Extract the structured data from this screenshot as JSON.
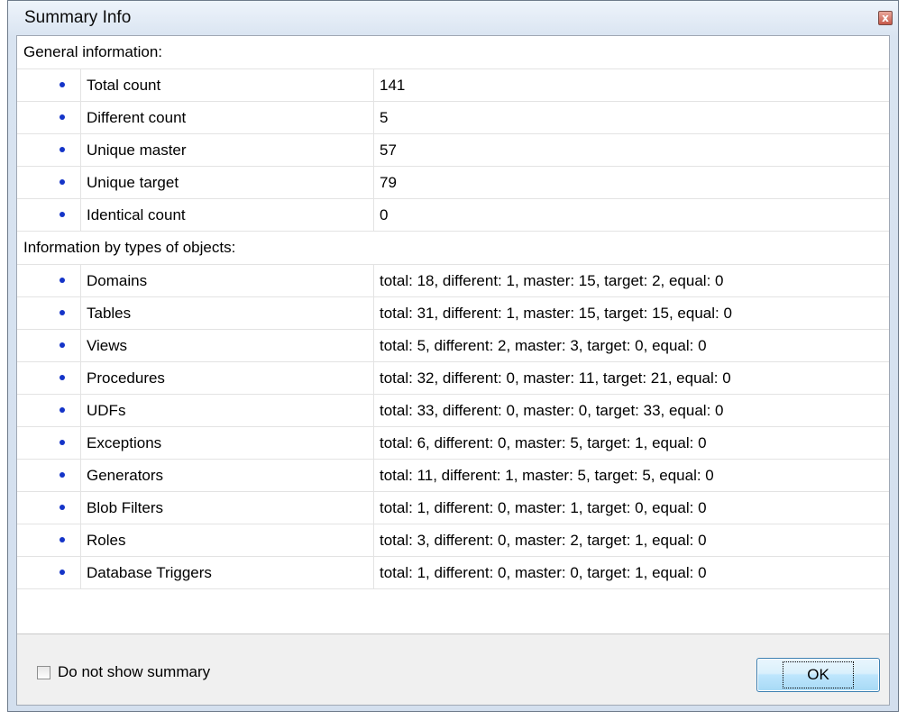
{
  "window": {
    "title": "Summary Info",
    "close_label": "x"
  },
  "general": {
    "header": "General information:",
    "rows": [
      {
        "name": "Total count",
        "value": "141"
      },
      {
        "name": "Different count",
        "value": "5"
      },
      {
        "name": "Unique master",
        "value": "57"
      },
      {
        "name": "Unique target",
        "value": "79"
      },
      {
        "name": "Identical count",
        "value": "0"
      }
    ]
  },
  "by_types": {
    "header": "Information by types of objects:",
    "rows": [
      {
        "name": "Domains",
        "value": "total: 18, different: 1, master: 15, target: 2, equal: 0"
      },
      {
        "name": "Tables",
        "value": "total: 31, different: 1, master: 15, target: 15, equal: 0"
      },
      {
        "name": "Views",
        "value": "total: 5, different: 2, master: 3, target: 0, equal: 0"
      },
      {
        "name": "Procedures",
        "value": "total: 32, different: 0, master: 11, target: 21, equal: 0"
      },
      {
        "name": "UDFs",
        "value": "total: 33, different: 0, master: 0, target: 33, equal: 0"
      },
      {
        "name": "Exceptions",
        "value": "total: 6, different: 0, master: 5, target: 1, equal: 0"
      },
      {
        "name": "Generators",
        "value": "total: 11, different: 1, master: 5, target: 5, equal: 0"
      },
      {
        "name": "Blob Filters",
        "value": "total: 1, different: 0, master: 1, target: 0, equal: 0"
      },
      {
        "name": "Roles",
        "value": "total: 3, different: 0, master: 2, target: 1, equal: 0"
      },
      {
        "name": "Database Triggers",
        "value": "total: 1, different: 0, master: 0, target: 1, equal: 0"
      }
    ]
  },
  "footer": {
    "checkbox_label": "Do not show summary",
    "checkbox_checked": false,
    "ok_label": "OK"
  },
  "colors": {
    "bullet": "#1434c8",
    "ok_border": "#3c7fb1"
  }
}
